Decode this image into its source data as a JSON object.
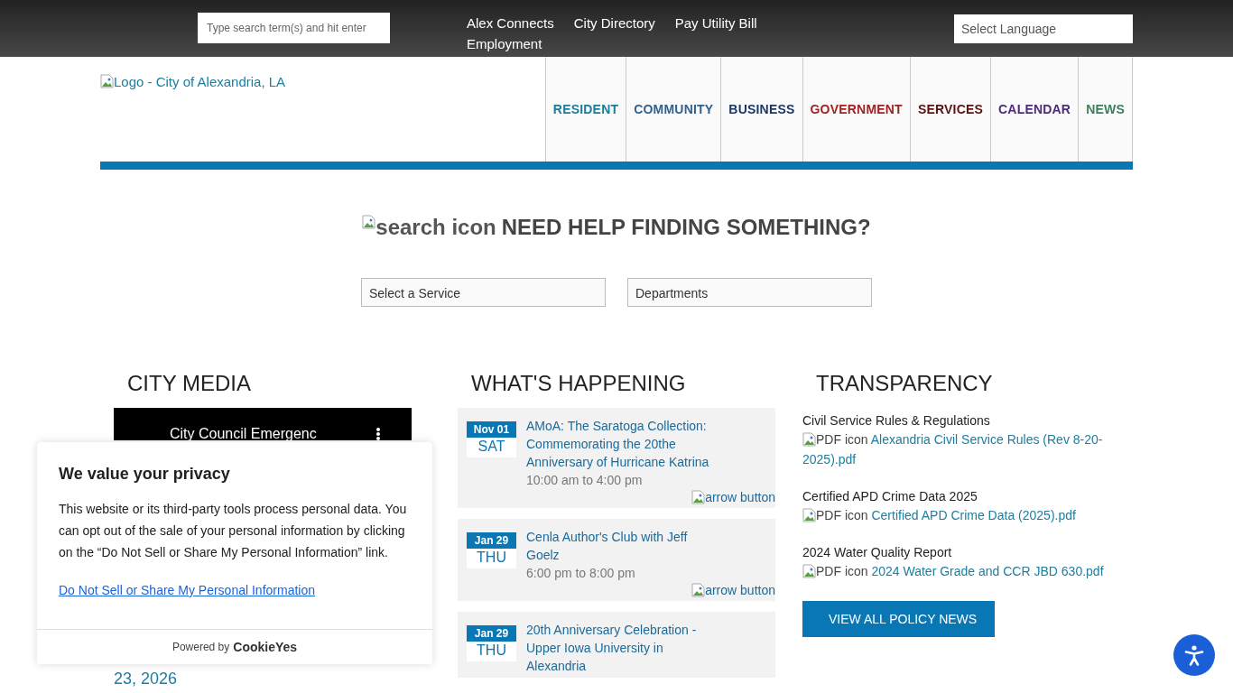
{
  "top_bar": {
    "search": {
      "placeholder": "Type search term(s) and hit enter"
    },
    "links": [
      "Alex Connects",
      "City Directory",
      "Pay Utility Bill",
      "Employment"
    ],
    "language_select": {
      "value": "Select Language"
    }
  },
  "header": {
    "logo_alt": "Logo - City of Alexandria, LA",
    "nav": [
      {
        "label": "RESIDENT",
        "color": "#1b7e9a"
      },
      {
        "label": "COMMUNITY",
        "color": "#33618f"
      },
      {
        "label": "BUSINESS",
        "color": "#1b3866"
      },
      {
        "label": "GOVERNMENT",
        "color": "#a02222"
      },
      {
        "label": "SERVICES",
        "color": "#5c1212"
      },
      {
        "label": "CALENDAR",
        "color": "#4d2b7c"
      },
      {
        "label": "NEWS",
        "color": "#3d7f5c"
      }
    ]
  },
  "help": {
    "icon_alt": "search icon",
    "title": "NEED HELP FINDING SOMETHING?",
    "selects": [
      {
        "value": "Select a Service"
      },
      {
        "value": "Departments"
      }
    ]
  },
  "city_media": {
    "title": "CITY MEDIA",
    "video_title": "City Council Emergenc",
    "link": "23, 2026"
  },
  "whats_happening": {
    "title": "WHAT'S HAPPENING",
    "events": [
      {
        "month_day": "Nov 01",
        "weekday": "SAT",
        "title": "AMoA: The Saratoga Collection: Commemorating the 20the Anniversary of Hurricane Katrina",
        "time": "10:00 am to 4:00 pm",
        "more_alt": "arrow button"
      },
      {
        "month_day": "Jan 29",
        "weekday": "THU",
        "title": "Cenla Author's Club with Jeff Goelz",
        "time": "6:00 pm to 8:00 pm",
        "more_alt": "arrow button"
      },
      {
        "month_day": "Jan 29",
        "weekday": "THU",
        "title": "20th Anniversary Celebration - Upper Iowa University in Alexandria"
      }
    ]
  },
  "transparency": {
    "title": "TRANSPARENCY",
    "documents": [
      {
        "heading": "Civil Service Rules & Regulations",
        "icon_alt": "PDF icon",
        "link": "Alexandria Civil Service Rules (Rev 8-20-2025).pdf"
      },
      {
        "heading": "Certified APD Crime Data 2025",
        "icon_alt": "PDF icon",
        "link": "Certified APD Crime Data (2025).pdf"
      },
      {
        "heading": "2024 Water Quality Report",
        "icon_alt": "PDF icon",
        "link": "2024 Water Grade and CCR JBD 630.pdf"
      }
    ],
    "button": "VIEW ALL POLICY NEWS"
  },
  "cookie_banner": {
    "title": "We value your privacy",
    "body": "This website or its third-party tools process personal data. You can opt out of the sale of your personal information by clicking on the “Do Not Sell or Share My Personal Information” link.",
    "link": "Do Not Sell or Share My Personal Information",
    "powered_by": "Powered by",
    "brand": "CookieYes"
  }
}
